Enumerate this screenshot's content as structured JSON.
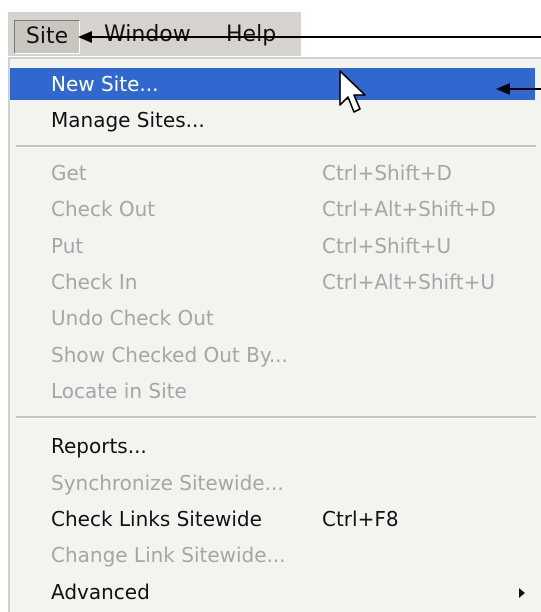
{
  "menubar": {
    "items": [
      "Site",
      "Window",
      "Help"
    ]
  },
  "menu": {
    "items": [
      {
        "label": "New Site...",
        "shortcut": "",
        "state": "highlighted"
      },
      {
        "label": "Manage Sites...",
        "shortcut": "",
        "state": "enabled"
      },
      {
        "label": "Get",
        "shortcut": "Ctrl+Shift+D",
        "state": "disabled"
      },
      {
        "label": "Check Out",
        "shortcut": "Ctrl+Alt+Shift+D",
        "state": "disabled"
      },
      {
        "label": "Put",
        "shortcut": "Ctrl+Shift+U",
        "state": "disabled"
      },
      {
        "label": "Check In",
        "shortcut": "Ctrl+Alt+Shift+U",
        "state": "disabled"
      },
      {
        "label": "Undo Check Out",
        "shortcut": "",
        "state": "disabled"
      },
      {
        "label": "Show Checked Out By...",
        "shortcut": "",
        "state": "disabled"
      },
      {
        "label": "Locate in Site",
        "shortcut": "",
        "state": "disabled"
      },
      {
        "label": "Reports...",
        "shortcut": "",
        "state": "enabled"
      },
      {
        "label": "Synchronize Sitewide...",
        "shortcut": "",
        "state": "disabled"
      },
      {
        "label": "Check Links Sitewide",
        "shortcut": "Ctrl+F8",
        "state": "enabled"
      },
      {
        "label": "Change Link Sitewide...",
        "shortcut": "",
        "state": "disabled"
      },
      {
        "label": "Advanced",
        "shortcut": "",
        "state": "enabled",
        "submenu": true
      }
    ]
  },
  "icons": {
    "cursor": "mouse-pointer-icon",
    "submenu_indicator": "triangle-right-icon",
    "annotation_pointer": "arrow-left-icon"
  },
  "colors": {
    "highlight": "#3168cf",
    "disabled_text": "#a6a6a6",
    "menubar_bg": "#d6d3ce",
    "menu_bg": "#f3f3f0"
  }
}
